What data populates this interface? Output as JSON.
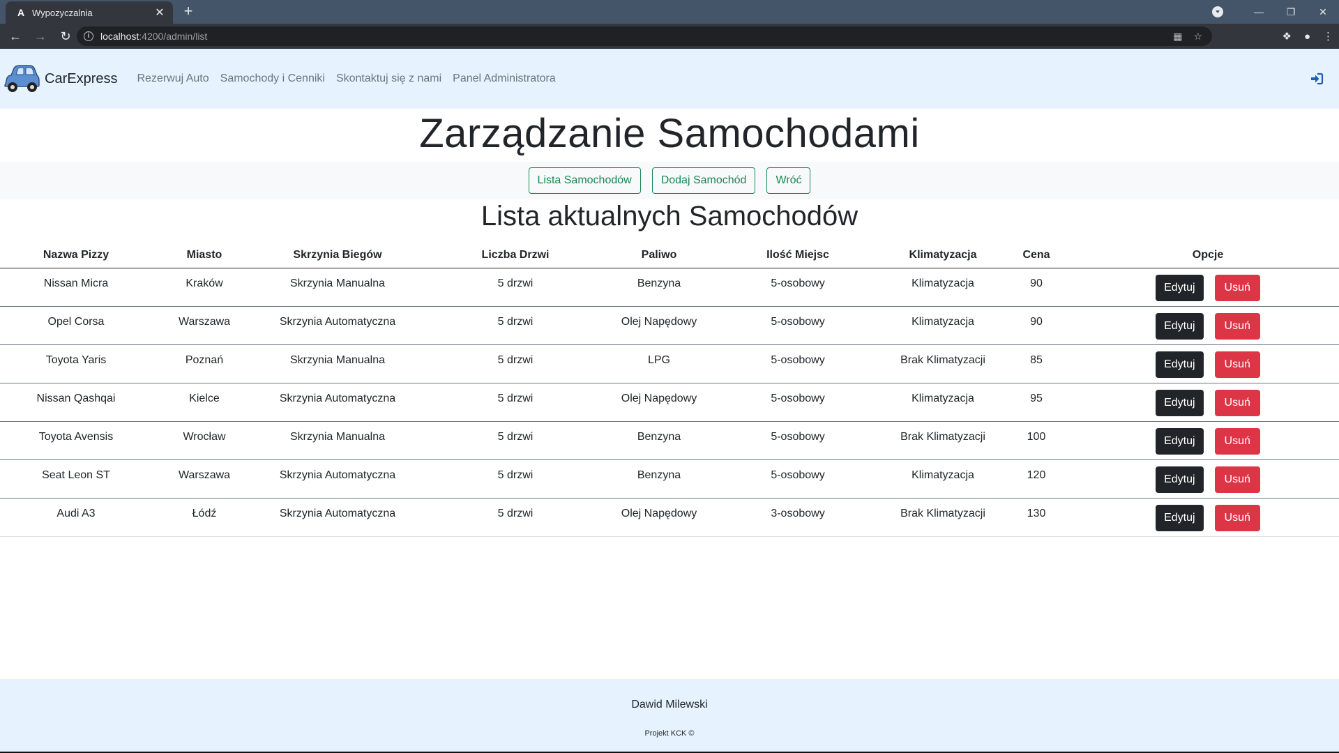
{
  "browser": {
    "tab_title": "Wypozyczalnia",
    "tab_favicon": "A",
    "url_host": "localhost",
    "url_path": ":4200/admin/list"
  },
  "navbar": {
    "brand": "CarExpress",
    "links": [
      "Rezerwuj Auto",
      "Samochody i Cenniki",
      "Skontaktuj się z nami",
      "Panel Administratora"
    ]
  },
  "page": {
    "title": "Zarządzanie Samochodami",
    "buttons": [
      "Lista Samochodów",
      "Dodaj Samochód",
      "Wróć"
    ],
    "section_title": "Lista aktualnych Samochodów"
  },
  "table": {
    "headers": [
      "Nazwa Pizzy",
      "Miasto",
      "Skrzynia Biegów",
      "Liczba Drzwi",
      "Paliwo",
      "Ilość Miejsc",
      "Klimatyzacja",
      "Cena",
      "Opcje"
    ],
    "edit_label": "Edytuj",
    "delete_label": "Usuń",
    "rows": [
      [
        "Nissan Micra",
        "Kraków",
        "Skrzynia Manualna",
        "5 drzwi",
        "Benzyna",
        "5-osobowy",
        "Klimatyzacja",
        "90"
      ],
      [
        "Opel Corsa",
        "Warszawa",
        "Skrzynia Automatyczna",
        "5 drzwi",
        "Olej Napędowy",
        "5-osobowy",
        "Klimatyzacja",
        "90"
      ],
      [
        "Toyota Yaris",
        "Poznań",
        "Skrzynia Manualna",
        "5 drzwi",
        "LPG",
        "5-osobowy",
        "Brak Klimatyzacji",
        "85"
      ],
      [
        "Nissan Qashqai",
        "Kielce",
        "Skrzynia Automatyczna",
        "5 drzwi",
        "Olej Napędowy",
        "5-osobowy",
        "Klimatyzacja",
        "95"
      ],
      [
        "Toyota Avensis",
        "Wrocław",
        "Skrzynia Manualna",
        "5 drzwi",
        "Benzyna",
        "5-osobowy",
        "Brak Klimatyzacji",
        "100"
      ],
      [
        "Seat Leon ST",
        "Warszawa",
        "Skrzynia Automatyczna",
        "5 drzwi",
        "Benzyna",
        "5-osobowy",
        "Klimatyzacja",
        "120"
      ],
      [
        "Audi A3",
        "Łódź",
        "Skrzynia Automatyczna",
        "5 drzwi",
        "Olej Napędowy",
        "3-osobowy",
        "Brak Klimatyzacji",
        "130"
      ]
    ]
  },
  "footer": {
    "author": "Dawid Milewski",
    "note": "Projekt KCK ©"
  },
  "colors": {
    "navbar_bg": "#e6f2fd",
    "success": "#198754",
    "dark": "#212529",
    "danger": "#dc3545"
  }
}
